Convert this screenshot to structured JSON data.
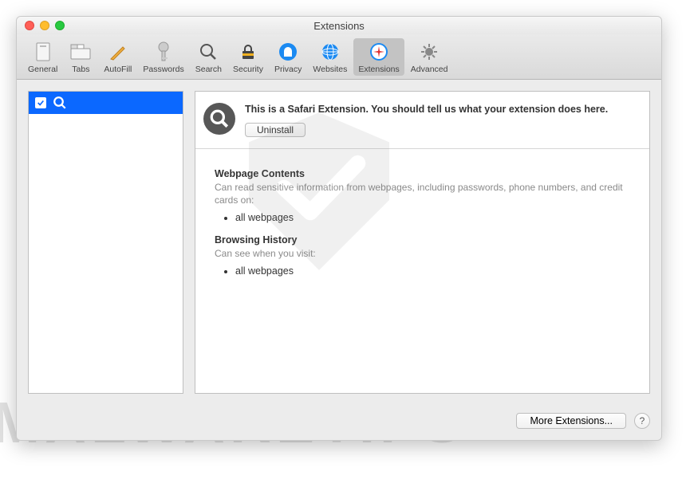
{
  "window": {
    "title": "Extensions"
  },
  "toolbar": {
    "items": [
      {
        "label": "General"
      },
      {
        "label": "Tabs"
      },
      {
        "label": "AutoFill"
      },
      {
        "label": "Passwords"
      },
      {
        "label": "Search"
      },
      {
        "label": "Security"
      },
      {
        "label": "Privacy"
      },
      {
        "label": "Websites"
      },
      {
        "label": "Extensions"
      },
      {
        "label": "Advanced"
      }
    ]
  },
  "sidebar": {
    "items": [
      {
        "name": ""
      }
    ]
  },
  "detail": {
    "description": "This is a Safari Extension. You should tell us what your extension does here.",
    "uninstall_label": "Uninstall",
    "permissions": {
      "webpage_contents": {
        "title": "Webpage Contents",
        "sub": "Can read sensitive information from webpages, including passwords, phone numbers, and credit cards on:",
        "items": [
          "all webpages"
        ]
      },
      "browsing_history": {
        "title": "Browsing History",
        "sub": "Can see when you visit:",
        "items": [
          "all webpages"
        ]
      }
    }
  },
  "footer": {
    "more_label": "More Extensions...",
    "help_label": "?"
  },
  "watermark": "MALWARETIPS"
}
